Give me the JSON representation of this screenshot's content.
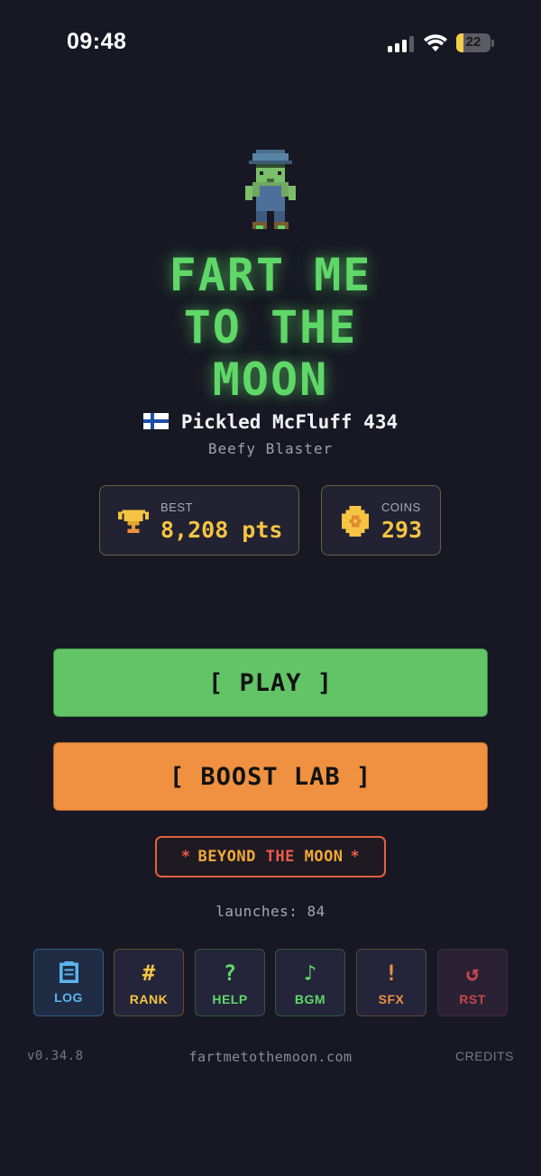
{
  "status_bar": {
    "time": "09:48",
    "battery_percent": "22",
    "battery_level": 0.22,
    "signal_bars_active": 3,
    "icons": [
      "signal-icon",
      "wifi-icon",
      "battery-icon"
    ]
  },
  "hero": {
    "avatar_icon": "pixel-character-icon",
    "title": "FART ME\nTO THE\nMOON",
    "title_color": "#5fd868"
  },
  "player": {
    "flag_icon": "finland-flag-icon",
    "name": "Pickled McFluff 434",
    "rank": "Beefy Blaster"
  },
  "stats": {
    "best": {
      "label": "BEST",
      "value": "8,208 pts",
      "icon": "trophy-icon"
    },
    "coins": {
      "label": "COINS",
      "value": "293",
      "icon": "coin-icon"
    },
    "accent_color": "#f5c443"
  },
  "actions": {
    "play_label": "[ PLAY ]",
    "play_color": "#62c467",
    "boost_label": "[ BOOST LAB ]",
    "boost_color": "#ef9140",
    "beyond": {
      "star": "*",
      "part1": "BEYOND",
      "part2": "THE",
      "part3": "MOON"
    }
  },
  "launches_text": "launches: 84",
  "tiles": [
    {
      "id": "log",
      "label": "LOG",
      "glyph": "",
      "icon": "log-icon",
      "color": "#5bb5ee"
    },
    {
      "id": "rank",
      "label": "RANK",
      "glyph": "#",
      "icon": "hash-icon",
      "color": "#f5c443"
    },
    {
      "id": "help",
      "label": "HELP",
      "glyph": "?",
      "icon": "question-icon",
      "color": "#5fd868"
    },
    {
      "id": "bgm",
      "label": "BGM",
      "glyph": "♪",
      "icon": "music-note-icon",
      "color": "#5fd868"
    },
    {
      "id": "sfx",
      "label": "SFX",
      "glyph": "!",
      "icon": "exclamation-icon",
      "color": "#ef9140"
    },
    {
      "id": "rst",
      "label": "RST",
      "glyph": "↺",
      "icon": "reset-icon",
      "color": "#c8464a"
    }
  ],
  "footer": {
    "version": "v0.34.8",
    "site": "fartmetothemoon.com",
    "credits": "CREDITS"
  }
}
